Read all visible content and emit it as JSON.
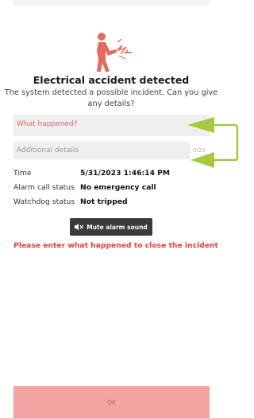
{
  "title": "Electrical accident detected",
  "subtitle": "The system detected a possible incident. Can you give any details?",
  "form": {
    "what_happened_placeholder": "What happened?",
    "details_placeholder": "Additional details",
    "details_counter": "0/20"
  },
  "info": [
    {
      "label": "Time",
      "value": "5/31/2023 1:46:14 PM"
    },
    {
      "label": "Alarm call status",
      "value": "No emergency call"
    },
    {
      "label": "Watchdog status",
      "value": "Not tripped"
    }
  ],
  "mute_button_label": "Mute alarm sound",
  "warning": "Please enter what happened to close the incident",
  "ok_label": "OK",
  "icons": {
    "hero": "electrical-accident-icon",
    "mute": "speaker-muted-icon"
  },
  "colors": {
    "accent": "#e0413f",
    "ok_button": "#f4a3a2",
    "annotation_arrow": "#a5c93f"
  }
}
